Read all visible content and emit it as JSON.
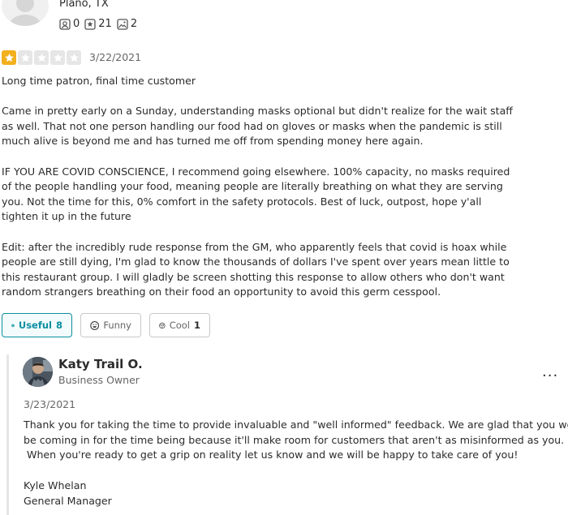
{
  "user": {
    "location": "Plano, TX",
    "friends": "0",
    "reviews": "21",
    "photos": "2"
  },
  "review": {
    "rating": 1,
    "rating_max": 5,
    "date": "3/22/2021",
    "paragraphs": [
      "Long time patron, final time customer",
      "Came in pretty early on a Sunday, understanding masks optional but didn't realize for the wait staff as well. That not one person handling our food had on gloves or masks when the pandemic is still much alive is beyond me and has turned me off from spending money here again.",
      "IF YOU ARE COVID CONSCIENCE, I recommend going elsewhere. 100% capacity, no masks required of the people handling your food, meaning people are literally breathing on what they are serving you. Not the time for this, 0% comfort in the safety protocols. Best of luck, outpost, hope y'all tighten it up in the future",
      "Edit: after the incredibly rude response from the GM, who apparently feels that covid is hoax while people are still dying, I'm glad to know the thousands of dollars I've spent over years mean little to this restaurant group. I will gladly be screen shotting this response to allow others who don't want random strangers breathing on their food an opportunity to avoid this germ cesspool."
    ]
  },
  "reactions": {
    "useful_label": "Useful",
    "useful_count": "8",
    "funny_label": "Funny",
    "cool_label": "Cool",
    "cool_count": "1"
  },
  "reply": {
    "owner_name": "Katy Trail O.",
    "owner_role": "Business Owner",
    "date": "3/23/2021",
    "lines": [
      "Thank you for taking the time to provide invaluable and \"well informed\" feedback.  We are glad that you won't",
      "be coming in for the time being because it'll make room for customers that aren't as misinformed as you.",
      " When you're ready to get a grip on reality let us know and we will be happy to take care of you!"
    ],
    "signature_name": "Kyle Whelan",
    "signature_title": "General Manager",
    "more_label": "..."
  },
  "colors": {
    "star": "#f2b01e",
    "useful_accent": "#0a8fa0"
  },
  "icons": [
    "user-avatar-placeholder",
    "friends-icon",
    "reviews-star-icon",
    "photos-icon",
    "star-icon",
    "useful-icon",
    "funny-icon",
    "cool-icon",
    "more-options-icon"
  ]
}
